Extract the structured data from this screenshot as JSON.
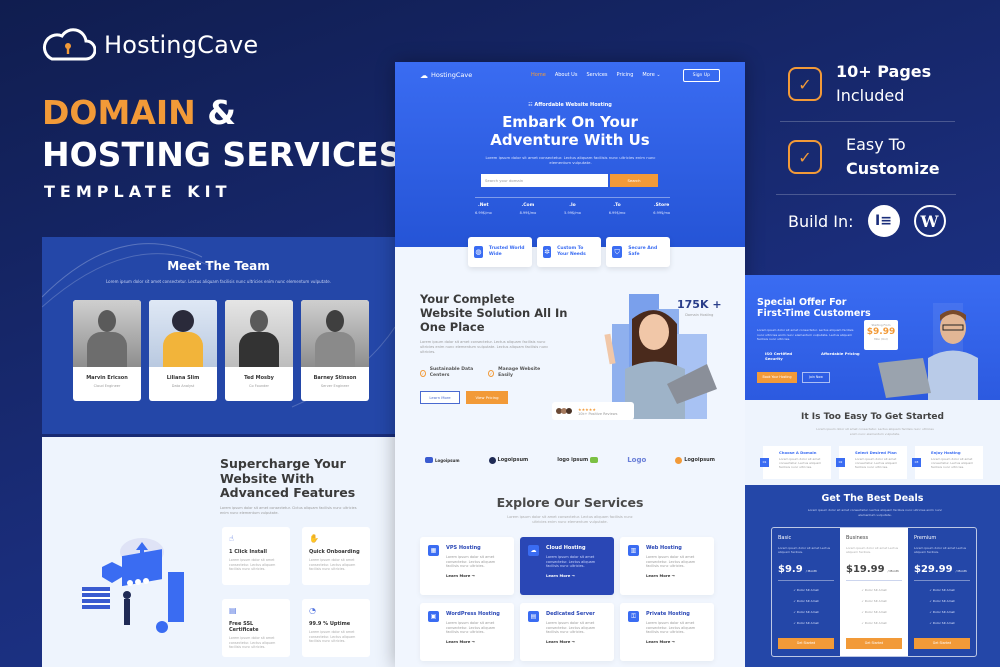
{
  "brand": {
    "name": "HostingCave",
    "logo_icon": "cloud-lock-icon"
  },
  "headline": {
    "accent": "DOMAIN",
    "amp": " &",
    "line2": "HOSTING SERVICES",
    "kit": "TEMPLATE KIT"
  },
  "features": [
    {
      "bold": "10+ Pages",
      "light": "Included",
      "icon": "check-icon"
    },
    {
      "light": "Easy To",
      "bold": "Customize",
      "icon": "check-icon"
    }
  ],
  "build_in": {
    "label": "Build In:",
    "icons": [
      "elementor-icon",
      "wordpress-icon"
    ]
  },
  "team": {
    "title": "Meet The Team",
    "subtitle": "Lorem ipsum dolor sit amet consectetur. Lectus aliquam facilisis nunc ultricies enim nunc elementum vulputate.",
    "members": [
      {
        "name": "Marvin Ericson",
        "role": "Cloud Engineer"
      },
      {
        "name": "Liliana Slim",
        "role": "Data Analyst"
      },
      {
        "name": "Ted Mosby",
        "role": "Co Founder"
      },
      {
        "name": "Barney Stinson",
        "role": "Server Engineer"
      }
    ]
  },
  "supercharge": {
    "title": "Supercharge Your Website With Advanced Features",
    "subtitle": "Lorem ipsum dolor sit amet consectetur. Cictus aliquam facilisis nunc ultricies enim nunc elementum vulputate.",
    "items": [
      {
        "icon": "pointer-icon",
        "name": "1 Click Install",
        "desc": "Lorem ipsum dolor sit amet consectetur. Lectus aliquam facilisis nunc ultricies."
      },
      {
        "icon": "handshake-icon",
        "name": "Quick Onboarding",
        "desc": "Lorem ipsum dolor sit amet consectetur. Lectus aliquam facilisis nunc ultricies."
      },
      {
        "icon": "certificate-icon",
        "name": "Free SSL Certificate",
        "desc": "Lorem ipsum dolor sit amet consectetur. Lectus aliquam facilisis nunc ultricies."
      },
      {
        "icon": "uptime-icon",
        "name": "99.9 % Uptime",
        "desc": "Lorem ipsum dolor sit amet consectetur. Lectus aliquam facilisis nunc ultricies."
      }
    ]
  },
  "home": {
    "nav": {
      "logo": "HostingCave",
      "links": [
        "Home",
        "About Us",
        "Services",
        "Pricing",
        "More ⌄"
      ],
      "signup": "Sign Up"
    },
    "hero": {
      "tag": "☷ Affordable Website Hosting",
      "title": "Embark On Your Adventure With Us",
      "text": "Lorem ipsum dolor sit amet consectetur. Lectus aliquam facilisis nunc ultricies enim nunc elementum vulputate.",
      "search_placeholder": "Search your domain",
      "search_button": "Search",
      "tlds": [
        {
          "name": ".Net",
          "price": "6.99$/mo"
        },
        {
          "name": ".Com",
          "price": "8.99$/mo"
        },
        {
          "name": ".Io",
          "price": "5.99$/mo"
        },
        {
          "name": ".To",
          "price": "6.99$/mo"
        },
        {
          "name": ".Store",
          "price": "6.99$/mo"
        }
      ]
    },
    "badges": [
      {
        "icon": "globe-icon",
        "text": "Trusted World Wide"
      },
      {
        "icon": "gear-icon",
        "text": "Custom To Your Needs"
      },
      {
        "icon": "shield-icon",
        "text": "Secure And Safe"
      }
    ],
    "solution": {
      "title": "Your Complete Website Solution All In One Place",
      "text": "Lorem ipsum dolor sit amet consectetur. Lectus aliquam facilisis nunc ultricies enim nunc elementum vulputate. Lectus aliquam facilisis nunc ultricies.",
      "checks": [
        "Sustainable Data Centers",
        "Manage Website Easily"
      ],
      "learn_more": "Learn More",
      "view_pricing": "View Pricing",
      "stat_value": "175K +",
      "stat_label": "Domain Hosting",
      "review_stars": "★★★★★",
      "review_text": "10k+ Positive Reviews"
    },
    "logos": [
      "Logoipsum",
      "Logoipsum",
      "logo ipsum",
      "Logo",
      "Logoipsum"
    ],
    "services": {
      "title": "Explore Our Services",
      "text": "Lorem ipsum dolor sit amet consectetur. Lectus aliquam facilisis nunc ultricies enim nunc elementum vulputate.",
      "items": [
        {
          "icon": "server-icon",
          "name": "VPS Hosting",
          "desc": "Lorem ipsum dolor sit amet consectetur. Lectus aliquam facilisis nunc ultricies.",
          "cta": "Learn More →"
        },
        {
          "icon": "cloud-icon",
          "name": "Cloud Hosting",
          "desc": "Lorem ipsum dolor sit amet consectetur. Lectus aliquam facilisis nunc ultricies.",
          "cta": "Learn More →"
        },
        {
          "icon": "web-icon",
          "name": "Web Hosting",
          "desc": "Lorem ipsum dolor sit amet consectetur. Lectus aliquam facilisis nunc ultricies.",
          "cta": "Learn More →"
        },
        {
          "icon": "wordpress-icon",
          "name": "WordPress Hosting",
          "desc": "Lorem ipsum dolor sit amet consectetur. Lectus aliquam facilisis nunc ultricies.",
          "cta": "Learn More →"
        },
        {
          "icon": "database-icon",
          "name": "Dedicated Server",
          "desc": "Lorem ipsum dolor sit amet consectetur. Lectus aliquam facilisis nunc ultricies.",
          "cta": "Learn More →"
        },
        {
          "icon": "lock-icon",
          "name": "Private Hosting",
          "desc": "Lorem ipsum dolor sit amet consectetur. Lectus aliquam facilisis nunc ultricies.",
          "cta": "Learn More →"
        }
      ]
    }
  },
  "offer": {
    "title": "Special Offer For First-Time Customers",
    "text": "Lorem ipsum dolor sit amet consectetur. Lectus aliquam facilisis nunc ultricies enim nunc elementum vulputate. Lectus aliquam facilisis nunc ultricies.",
    "features": [
      "ISO Certified Security",
      "Affordable Pricing"
    ],
    "btn_primary": "Book Your Hosting",
    "btn_secondary": "Join Now",
    "price_label": "Starting From",
    "price": "$9.99",
    "price_period": "Mon (Unl)"
  },
  "steps": {
    "title": "It Is Too Easy To Get Started",
    "text": "Lorem ipsum dolor sit amet consectetur. Lectus aliquam facilisis nunc ultricies enim nunc elementum vulputate.",
    "items": [
      {
        "num": "01",
        "name": "Choose A Domain",
        "desc": "Lorem ipsum dolor sit amet consectetur. Lectus aliquam facilisis nunc ultricies."
      },
      {
        "num": "02",
        "name": "Select Desired Plan",
        "desc": "Lorem ipsum dolor sit amet consectetur. Lectus aliquam facilisis nunc ultricies."
      },
      {
        "num": "03",
        "name": "Enjoy Hosting",
        "desc": "Lorem ipsum dolor sit amet consectetur. Lectus aliquam facilisis nunc ultricies."
      }
    ]
  },
  "deals": {
    "title": "Get The Best Deals",
    "text": "Lorem ipsum dolor sit amet consectetur. Lectus aliquam facilisis nunc ultricies enim nunc elementum vulputate.",
    "plans": [
      {
        "name": "Basic",
        "desc": "Lorem ipsum dolor sit amet Lectus aliquam facilisis.",
        "price": "$9.9",
        "period": "/ Month",
        "items": [
          "Dolor Sit Amet",
          "Dolor Sit Amet",
          "Dolor Sit Amet",
          "Dolor Sit Amet"
        ],
        "cta": "Get Started"
      },
      {
        "name": "Business",
        "desc": "Lorem ipsum dolor sit amet Lectus aliquam facilisis.",
        "price": "$19.99",
        "period": "/ Month",
        "items": [
          "Dolor Sit Amet",
          "Dolor Sit Amet",
          "Dolor Sit Amet",
          "Dolor Sit Amet"
        ],
        "cta": "Get Started"
      },
      {
        "name": "Premium",
        "desc": "Lorem ipsum dolor sit amet Lectus aliquam facilisis.",
        "price": "$29.99",
        "period": "/ Month",
        "items": [
          "Dolor Sit Amet",
          "Dolor Sit Amet",
          "Dolor Sit Amet",
          "Dolor Sit Amet"
        ],
        "cta": "Get Started"
      }
    ]
  },
  "colors": {
    "accent": "#f29a38",
    "primary": "#3a6cf2",
    "dark_blue": "#2447a8",
    "background": "#101d4f"
  }
}
